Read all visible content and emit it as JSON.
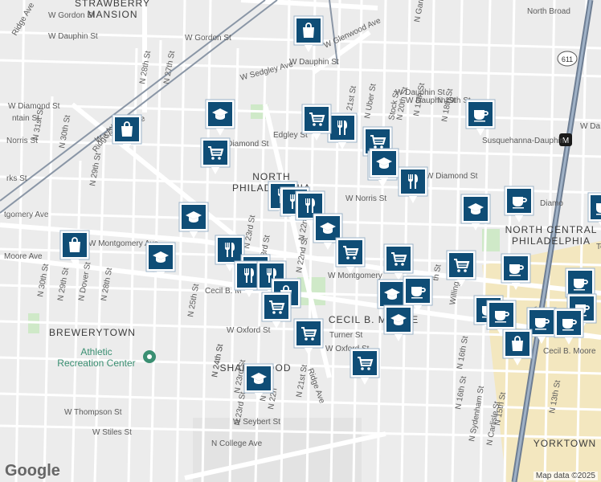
{
  "map": {
    "attribution": "Map data ©2025",
    "logo": "Google",
    "areas": [
      {
        "id": "strawberry-mansion",
        "lines": [
          "STRAWBERRY",
          "MANSION"
        ]
      },
      {
        "id": "north-philadelphia",
        "lines": [
          "NORTH",
          "PHILADELPHIA"
        ]
      },
      {
        "id": "north-central-philadelphia",
        "lines": [
          "NORTH CENTRAL",
          "PHILADELPHIA"
        ]
      },
      {
        "id": "brewerytown",
        "lines": [
          "BREWERYTOWN"
        ]
      },
      {
        "id": "sharswood",
        "lines": [
          "SHARSWOOD"
        ]
      },
      {
        "id": "cecil-b-moore",
        "lines": [
          "CECIL B. MOORE"
        ]
      },
      {
        "id": "yorktown",
        "lines": [
          "YORKTOWN"
        ]
      }
    ],
    "pois": [
      {
        "id": "athletic-recreation-center",
        "lines": [
          "Athletic",
          "Recreation Center"
        ]
      },
      {
        "id": "susquehanna-dauphin",
        "lines": [
          "Susquehanna-Dauphin"
        ]
      },
      {
        "id": "north-broad",
        "lines": [
          "North Broad"
        ]
      }
    ],
    "route_badge": "611",
    "streets": [
      "W Gordon St",
      "Ridge Ave",
      "W Dauphin St",
      "W Sedgley Ave",
      "W Glenwood Ave",
      "W Gordon St",
      "W Dauphin St",
      "W Diamond St",
      "ntain St",
      "W Sedgley Ave",
      "Norris St",
      "rks St",
      "Ridge Ave",
      "N 29th St",
      "N 28th St",
      "N 27th St",
      "N 31st St",
      "N 30th St",
      "Edgley St",
      "W Diamond St",
      "W Diamond St",
      "W Norris St",
      "tgomery Ave",
      "W Montgomery Ave",
      "Moore Ave",
      "N 23rd St",
      "N 22nd St",
      "N 21st St",
      "N Uber St",
      "Stock St",
      "N 20th St",
      "N 19th St",
      "N 18th St",
      "N Garnet St",
      "N 16th St",
      "W Dauphin St",
      "Diamo",
      "W Montgomery",
      "Cecil B. M",
      "23rd St",
      "N 22nd St",
      "Willing",
      "N 30th St",
      "N Dover St",
      "N 28th St",
      "N 29th St",
      "N 25th St",
      "N 24th St",
      "W Oxford St",
      "Turner St",
      "W Oxford St",
      "Ridge Ave",
      "N 21st St",
      "N 23rd St",
      "N 22n",
      "W Seybert St",
      "W Thompson St",
      "W Stiles St",
      "N College Ave",
      "N 16th St",
      "N Sydenham St",
      "N 15th St",
      "N Carlisle St",
      "N 13th St",
      "Cecil B. Moore",
      "W Da",
      "Te",
      "ad St",
      "N 19th St",
      "th St",
      "W Dauphin St",
      "N 24th St",
      "N 22nd St",
      "N 23rd St"
    ],
    "markers": [
      {
        "icon": "shopping-bag"
      },
      {
        "icon": "graduation-cap"
      },
      {
        "icon": "shopping-bag"
      },
      {
        "icon": "shopping-cart"
      },
      {
        "icon": "restaurant"
      },
      {
        "icon": "shopping-cart"
      },
      {
        "icon": "coffee"
      },
      {
        "icon": "shopping-cart"
      },
      {
        "icon": "shopping-cart"
      },
      {
        "icon": "graduation-cap"
      },
      {
        "icon": "restaurant"
      },
      {
        "icon": "restaurant"
      },
      {
        "icon": "restaurant"
      },
      {
        "icon": "restaurant"
      },
      {
        "icon": "graduation-cap"
      },
      {
        "icon": "coffee"
      },
      {
        "icon": "coffee"
      },
      {
        "icon": "graduation-cap"
      },
      {
        "icon": "shopping-bag"
      },
      {
        "icon": "graduation-cap"
      },
      {
        "icon": "restaurant"
      },
      {
        "icon": "graduation-cap"
      },
      {
        "icon": "shopping-cart"
      },
      {
        "icon": "shopping-cart"
      },
      {
        "icon": "shopping-cart"
      },
      {
        "icon": "graduation-cap"
      },
      {
        "icon": "coffee"
      },
      {
        "icon": "coffee"
      },
      {
        "icon": "coffee"
      },
      {
        "icon": "restaurant"
      },
      {
        "icon": "restaurant"
      },
      {
        "icon": "shopping-bag"
      },
      {
        "icon": "shopping-cart"
      },
      {
        "icon": "graduation-cap"
      },
      {
        "icon": "graduation-cap"
      },
      {
        "icon": "shopping-cart"
      },
      {
        "icon": "shopping-cart"
      },
      {
        "icon": "graduation-cap"
      },
      {
        "icon": "coffee"
      },
      {
        "icon": "coffee"
      },
      {
        "icon": "coffee"
      },
      {
        "icon": "coffee"
      },
      {
        "icon": "coffee"
      },
      {
        "icon": "shopping-bag"
      }
    ],
    "colors": {
      "marker": "#0f4d76",
      "park": "#cfe9c8",
      "rail": "#6e7e93",
      "highway": "#f2c866"
    }
  }
}
